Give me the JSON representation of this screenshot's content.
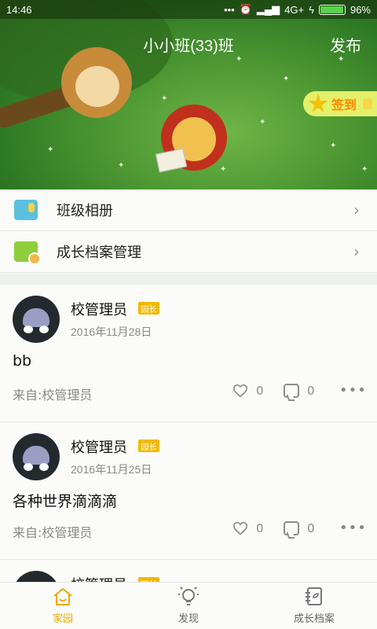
{
  "status_bar": {
    "time": "14:46",
    "network": "4G+",
    "battery": "96%",
    "battery_level": 0.96
  },
  "header": {
    "title": "小小班(33)班",
    "publish_label": "发布",
    "checkin_label": "签到"
  },
  "menu": {
    "items": [
      {
        "label": "班级相册",
        "icon": "album-icon"
      },
      {
        "label": "成长档案管理",
        "icon": "growth-record-icon"
      }
    ]
  },
  "feed": {
    "from_prefix": "来自:",
    "posts": [
      {
        "author": "校管理员",
        "badge": "园长",
        "date": "2016年11月28日",
        "content": "bb",
        "from": "校管理员",
        "likes": "0",
        "comments": "0"
      },
      {
        "author": "校管理员",
        "badge": "园长",
        "date": "2016年11月25日",
        "content": "各种世界滴滴滴",
        "from": "校管理员",
        "likes": "0",
        "comments": "0"
      },
      {
        "author": "校管理员",
        "badge": "园长"
      }
    ]
  },
  "tabbar": {
    "tabs": [
      {
        "label": "家园",
        "active": true,
        "icon": "home-icon"
      },
      {
        "label": "发现",
        "active": false,
        "icon": "lightbulb-icon"
      },
      {
        "label": "成长档案",
        "active": false,
        "icon": "growth-archive-icon"
      }
    ]
  },
  "colors": {
    "accent": "#f0a800",
    "badge": "#f2b900",
    "checkin_bg": "#e4f06a",
    "checkin_text": "#ff8a00"
  }
}
